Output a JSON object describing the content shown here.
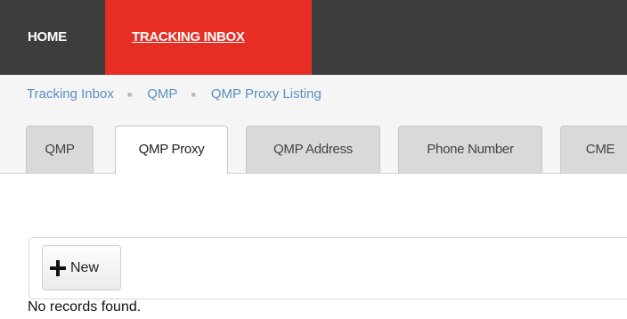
{
  "nav": {
    "home": "HOME",
    "tracking_inbox": "TRACKING INBOX"
  },
  "breadcrumb": [
    "Tracking Inbox",
    "QMP",
    "QMP Proxy Listing"
  ],
  "breadcrumb_separator": "■",
  "tabs": [
    {
      "label": "QMP",
      "active": false
    },
    {
      "label": "QMP Proxy",
      "active": true
    },
    {
      "label": "QMP Address",
      "active": false
    },
    {
      "label": "Phone Number",
      "active": false
    },
    {
      "label": "CME",
      "active": false
    }
  ],
  "toolbar": {
    "new_label": "New",
    "new_icon": "plus-icon"
  },
  "empty_message": "No records found.",
  "colors": {
    "nav_bg": "#3d3d3d",
    "nav_active": "#e62e25",
    "link": "#5a8fc4"
  }
}
